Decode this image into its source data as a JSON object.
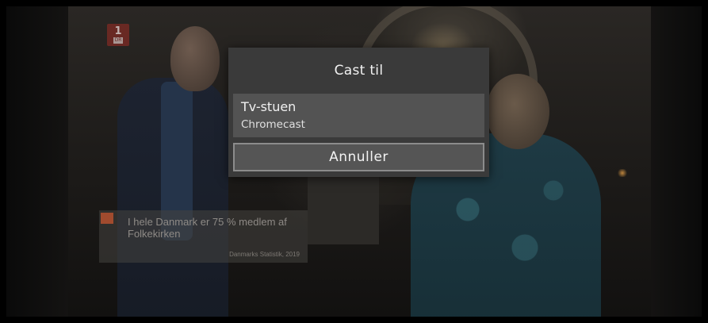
{
  "channel_logo": {
    "number": "1",
    "brand": "DR"
  },
  "info_card": {
    "fact": "I hele Danmark er 75 % medlem af Folkekirken",
    "source": "Danmarks Statistik, 2019",
    "marker_color": "#b5502f"
  },
  "cast_dialog": {
    "title": "Cast til",
    "devices": [
      {
        "name": "Tv-stuen",
        "type": "Chromecast"
      }
    ],
    "cancel_label": "Annuller"
  },
  "colors": {
    "dialog_bg": "#3a3a3a",
    "device_row_bg": "#535353",
    "button_border": "#8c8c8c"
  }
}
